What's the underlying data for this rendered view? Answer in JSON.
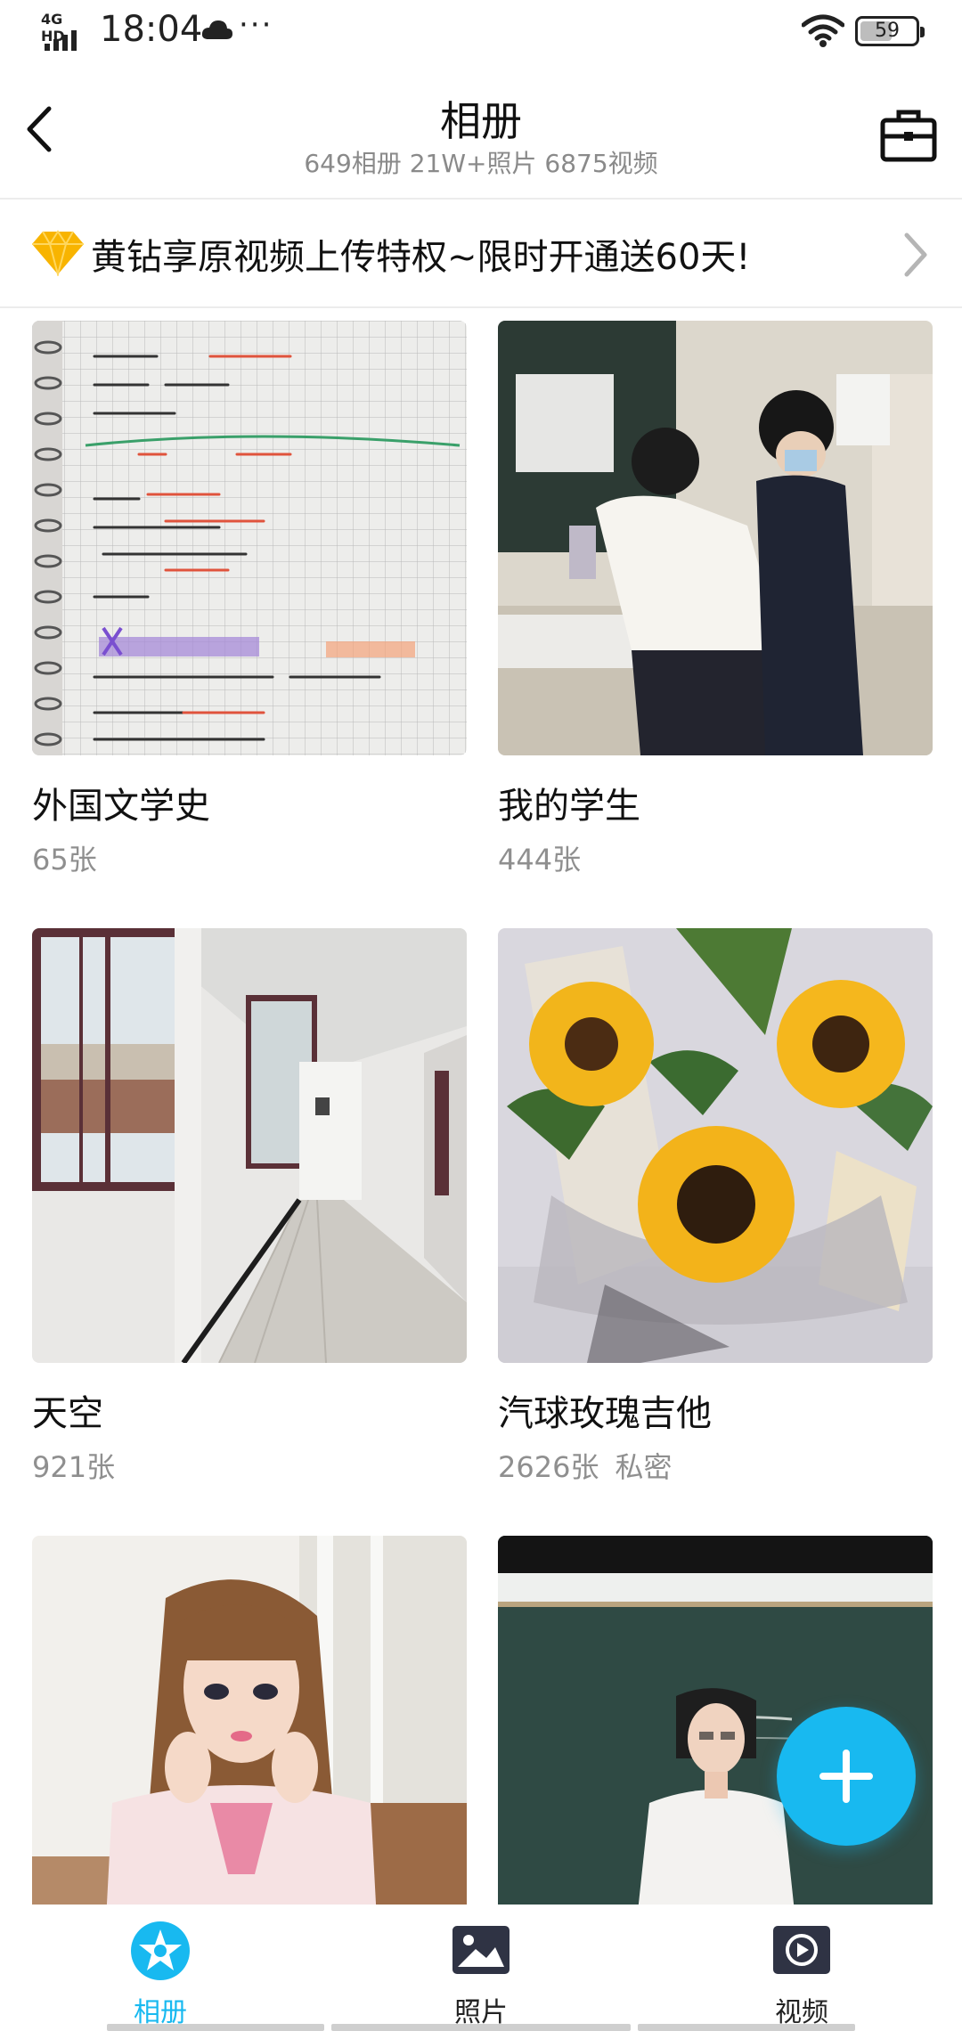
{
  "status_bar": {
    "network": "4G HD",
    "time": "18:04",
    "more": "···",
    "battery": "59",
    "battery_level": 0.59
  },
  "header": {
    "title": "相册",
    "subtitle": "649相册  21W+照片  6875视频"
  },
  "promo": {
    "text": "黄钻享原视频上传特权~限时开通送60天!"
  },
  "albums": [
    {
      "name": "外国文学史",
      "count": "65张"
    },
    {
      "name": "我的学生",
      "count": "444张"
    },
    {
      "name": "天空",
      "count": "921张"
    },
    {
      "name": "汽球玫瑰吉他",
      "count": "2626张",
      "badge": "私密"
    },
    {
      "name": "",
      "count": ""
    },
    {
      "name": "",
      "count": ""
    }
  ],
  "bottom_nav": {
    "items": [
      {
        "label": "相册",
        "icon": "album-star-icon",
        "active": true
      },
      {
        "label": "照片",
        "icon": "photo-icon",
        "active": false
      },
      {
        "label": "视频",
        "icon": "video-play-icon",
        "active": false
      }
    ]
  },
  "colors": {
    "accent": "#18b9f0",
    "diamond": "#f8b400",
    "secondary_text": "#8f8f8f"
  }
}
